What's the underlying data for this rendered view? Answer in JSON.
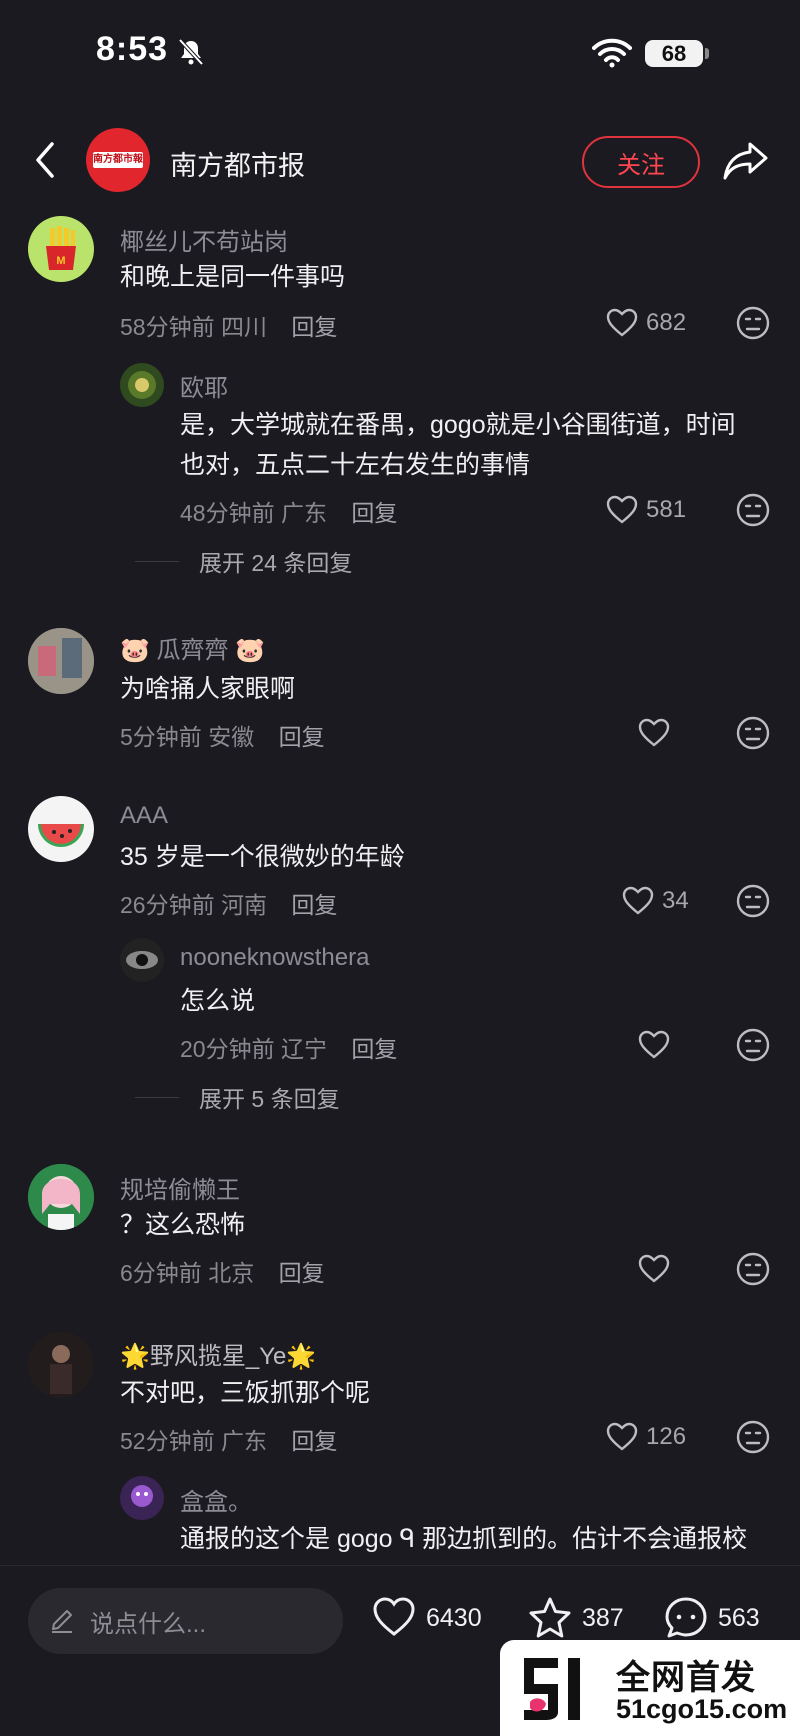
{
  "status": {
    "time": "8:53",
    "battery": "68"
  },
  "header": {
    "account_name": "南方都市报",
    "logo_text": "南方都市報",
    "follow_label": "关注"
  },
  "comments": [
    {
      "user": "椰丝儿不苟站岗",
      "text": "和晚上是同一件事吗",
      "time": "58分钟前",
      "location": "四川",
      "reply": "回复",
      "likes": "682"
    },
    {
      "user": "欧耶",
      "text1": "是，大学城就在番禺，gogo就是小谷围街道，时间",
      "text2": "也对，五点二十左右发生的事情",
      "time": "48分钟前",
      "location": "广东",
      "reply": "回复",
      "likes": "581"
    },
    {
      "expand": "展开 24 条回复"
    },
    {
      "user": "🐷 瓜齊齊 🐷",
      "text": "为啥捅人家眼啊",
      "time": "5分钟前",
      "location": "安徽",
      "reply": "回复",
      "likes": ""
    },
    {
      "user": "AAA",
      "text": "35 岁是一个很微妙的年龄",
      "time": "26分钟前",
      "location": "河南",
      "reply": "回复",
      "likes": "34"
    },
    {
      "user": "nooneknowsthera",
      "text": "怎么说",
      "time": "20分钟前",
      "location": "辽宁",
      "reply": "回复",
      "likes": ""
    },
    {
      "expand": "展开 5 条回复"
    },
    {
      "user": "规培偷懒王",
      "text": "？这么恐怖",
      "time": "6分钟前",
      "location": "北京",
      "reply": "回复",
      "likes": ""
    },
    {
      "user": "🌟野风揽星_Ye🌟",
      "text": "不对吧，三饭抓那个呢",
      "time": "52分钟前",
      "location": "广东",
      "reply": "回复",
      "likes": "126"
    },
    {
      "user": "盒盒。",
      "text": "通报的这个是 gogo ᑫ 那边抓到的。估计不会通报校"
    }
  ],
  "bottom": {
    "placeholder": "说点什么...",
    "likes": "6430",
    "favorites": "387",
    "comments": "563"
  },
  "watermark": {
    "title": "全网首发",
    "url": "51cgo15.com"
  },
  "colors": {
    "accent": "#e0333d",
    "background": "#1b1a20"
  }
}
